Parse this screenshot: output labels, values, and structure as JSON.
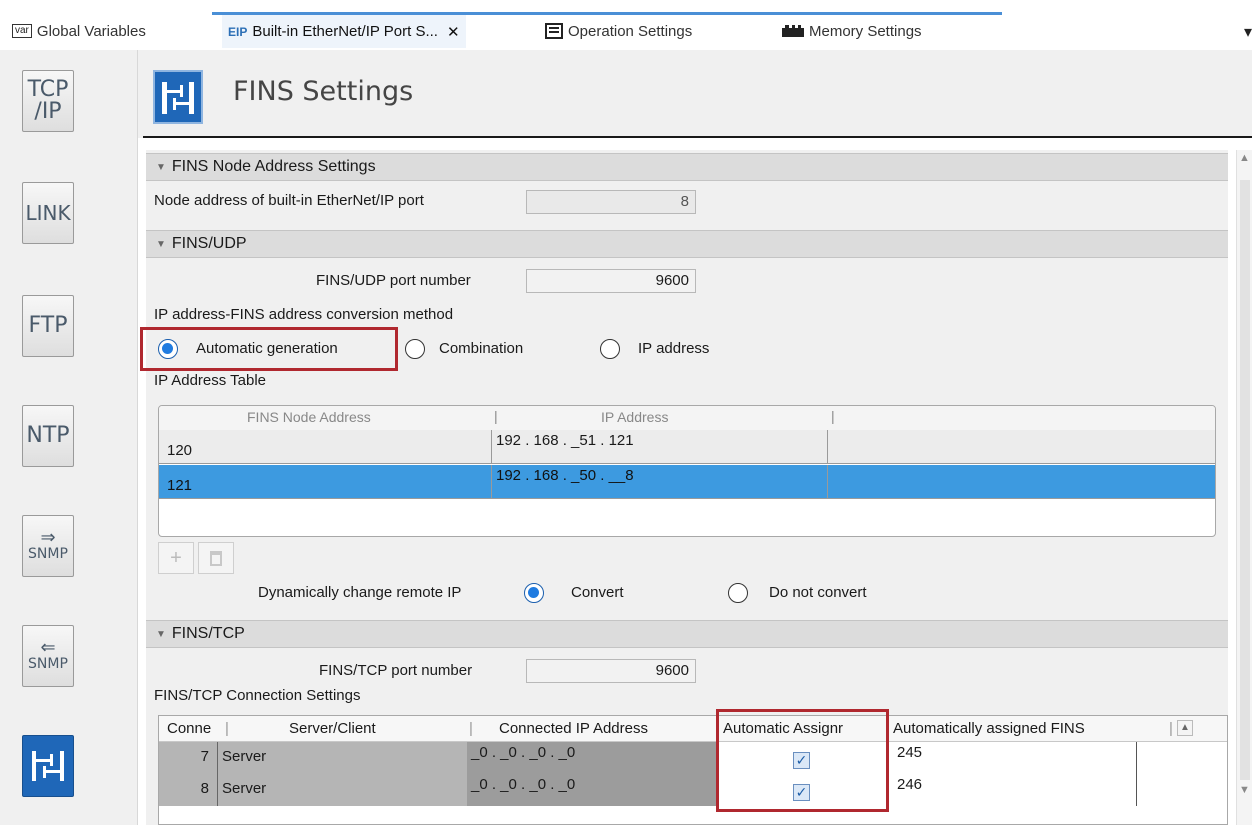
{
  "tabs": [
    {
      "icon": "var",
      "label": "Global Variables"
    },
    {
      "icon": "EIP",
      "label": "Built-in EtherNet/IP Port S..."
    },
    {
      "icon": "op",
      "label": "Operation Settings"
    },
    {
      "icon": "mem",
      "label": "Memory Settings"
    }
  ],
  "tab_close_glyph": "✕",
  "sidebar": {
    "tcpip_top": "TCP",
    "tcpip_bottom": "/IP",
    "link": "LINK",
    "ftp": "FTP",
    "ntp": "NTP",
    "snmp1_arrow": "⇒",
    "snmp1": "SNMP",
    "snmp2_arrow": "⇐",
    "snmp2": "SNMP"
  },
  "header": {
    "title": "FINS Settings"
  },
  "sections": {
    "node": "FINS Node Address Settings",
    "udp": "FINS/UDP",
    "tcp": "FINS/TCP"
  },
  "node": {
    "label": "Node address of built-in EtherNet/IP port",
    "value": "8"
  },
  "udp": {
    "port_label": "FINS/UDP port number",
    "port_value": "9600",
    "conversion_label": "IP address-FINS address conversion method",
    "options": [
      "Automatic generation",
      "Combination",
      "IP address"
    ],
    "selected": "Automatic generation",
    "table_label": "IP Address Table",
    "table_headers": [
      "FINS Node Address",
      "IP Address"
    ],
    "rows": [
      {
        "node": "120",
        "ip": "192 . 168 . _51 . 121"
      },
      {
        "node": "121",
        "ip": "192 . 168 . _50 . __8"
      }
    ],
    "add_glyph": "+",
    "delete_glyph": "🗑",
    "remote_ip_label": "Dynamically change remote IP",
    "remote_options": [
      "Convert",
      "Do not convert"
    ],
    "remote_selected": "Convert"
  },
  "tcp": {
    "port_label": "FINS/TCP port number",
    "port_value": "9600",
    "conn_label": "FINS/TCP Connection Settings",
    "headers": [
      "Conne",
      "Server/Client",
      "Connected IP Address",
      "Automatic Assignr",
      "Automatically assigned FINS"
    ],
    "rows": [
      {
        "conn": "7",
        "mode": "Server",
        "ip": "_0 . _0 . _0 . _0",
        "auto": true,
        "fins": "245"
      },
      {
        "conn": "8",
        "mode": "Server",
        "ip": "_0 . _0 . _0 . _0",
        "auto": true,
        "fins": "246"
      }
    ],
    "check_glyph": "✓"
  },
  "colors": {
    "accent": "#1f67b8",
    "highlight_box": "#b0282f",
    "selected_row": "#3d9ae0"
  }
}
